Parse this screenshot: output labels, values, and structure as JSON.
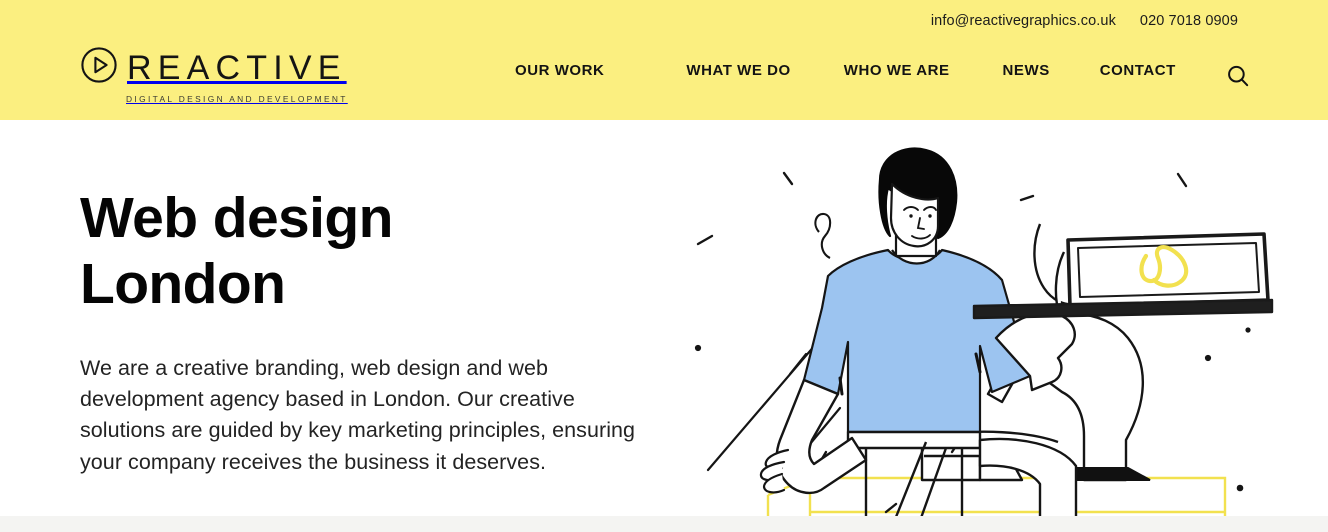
{
  "header": {
    "background_color": "#FBEF80",
    "contact": {
      "email": "info@reactivegraphics.co.uk",
      "phone": "020 7018 0909"
    },
    "logo": {
      "word": "REACTIVE",
      "tagline": "DIGITAL DESIGN AND DEVELOPMENT",
      "mark_icon": "play-circle-icon"
    },
    "nav": [
      {
        "label": "OUR WORK"
      },
      {
        "label": "WHAT WE DO"
      },
      {
        "label": "WHO WE ARE"
      },
      {
        "label": "NEWS"
      },
      {
        "label": "CONTACT"
      }
    ],
    "search_icon": "search-icon"
  },
  "hero": {
    "title_line1": "Web design",
    "title_line2": "London",
    "paragraph": "We are a creative branding, web design and web development agency based in London. Our creative solutions are guided by key marketing principles, ensuring your company receives the business it deserves.",
    "illustration": {
      "alt": "Line-art illustration of a seated woman in a light blue shirt holding up an open laptop displaying a yellow handwritten squiggle, surrounded by small confetti dashes and dots, on a yellow outlined platform",
      "shirt_color": "#9CC4F0",
      "accent_color": "#F2E14F",
      "line_color": "#111111"
    }
  },
  "colors": {
    "brand_yellow": "#FBEF80",
    "accent_yellow": "#F2E14F",
    "illustration_blue": "#9CC4F0",
    "text_dark": "#131313",
    "page_background": "#FFFFFF",
    "footer_strip": "#F4F4F2"
  }
}
